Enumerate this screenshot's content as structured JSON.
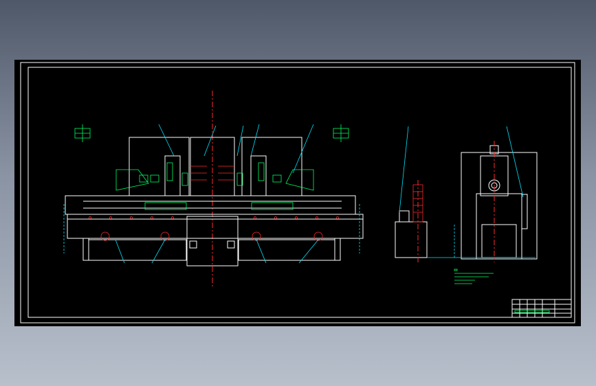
{
  "drawing": {
    "background": "#000000",
    "colors": {
      "outline": "#ffffff",
      "annotation": "#00ff66",
      "dimension": "#00e5ff",
      "centerline": "#ff2a2a"
    },
    "views": [
      "front-view",
      "side-view"
    ],
    "notes_present": true,
    "title_block_present": true
  }
}
